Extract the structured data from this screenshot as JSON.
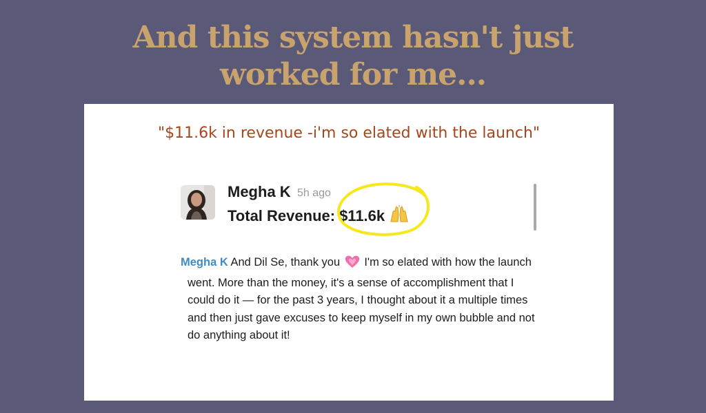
{
  "headline": {
    "line1": "And this system hasn't just",
    "line2": "worked for me..."
  },
  "testimonial": {
    "quote": "\"$11.6k in revenue -i'm so elated with the launch\"",
    "post": {
      "author": "Megha K",
      "time": "5h ago",
      "revenue_label": "Total Revenue:",
      "revenue_value": "$11.6k",
      "revenue_emoji": "raising-hands-icon",
      "highlight_color": "#f5e81c"
    },
    "message": {
      "mention": "Megha K",
      "line1_text": "And Dil Se, thank you",
      "line1_after": "I'm so elated with how the launch",
      "line2": "went. More than the money, it's a sense of accomplishment that I",
      "line3": "could do it — for the past 3 years, I thought about it a multiple times",
      "line4": "and then just gave excuses to keep myself in my own bubble and not",
      "line5": "do anything about it!",
      "heart_icon": "heart-icon"
    }
  },
  "colors": {
    "background": "#5a5977",
    "headline": "#c9a36e",
    "quote": "#a8451a",
    "mention": "#3f8bc4"
  }
}
